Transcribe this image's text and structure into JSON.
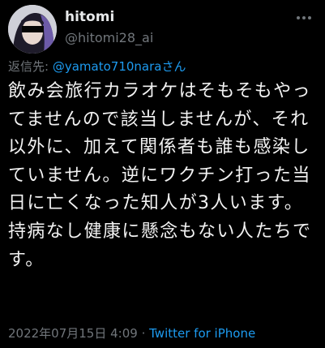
{
  "user": {
    "display_name": "hitomi",
    "handle": "@hitomi28_ai",
    "avatar_icon": "profile-photo",
    "more_icon": "ellipsis-icon"
  },
  "reply": {
    "prefix": "返信先:",
    "mention": "@yamato710naraさん"
  },
  "tweet": {
    "text": "飲み会旅行カラオケはそもそもやってませんので該当しませんが、それ以外に、加えて関係者も誰も感染していません。逆にワクチン打った当日に亡くなった知人が3人います。持病なし健康に懸念もない人たちです。"
  },
  "meta": {
    "timestamp": "2022年07月15日 4:09",
    "separator": " · ",
    "client": "Twitter for iPhone"
  },
  "colors": {
    "background": "#000000",
    "text": "#e7e9ea",
    "secondary": "#71767b",
    "accent": "#1d9bf0"
  }
}
